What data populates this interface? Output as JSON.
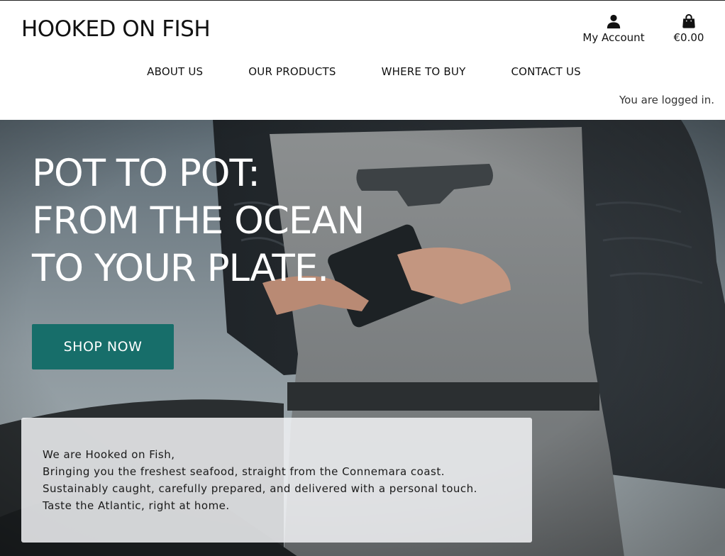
{
  "header": {
    "logo": "HOOKED ON FISH",
    "account_label": "My Account",
    "basket_total": "€0.00",
    "nav": [
      {
        "label": "ABOUT US"
      },
      {
        "label": "OUR PRODUCTS"
      },
      {
        "label": "WHERE TO BUY"
      },
      {
        "label": "CONTACT US"
      }
    ],
    "login_message": "You are logged in."
  },
  "hero": {
    "title_lines": [
      "POT TO POT:",
      "FROM THE OCEAN",
      "TO YOUR PLATE."
    ],
    "cta_label": "SHOP NOW",
    "cta_color": "#176e6a",
    "intro_lines": [
      "We are Hooked on Fish,",
      "Bringing you the freshest seafood, straight from the Connemara coast.",
      "Sustainably caught, carefully prepared, and delivered with a personal touch.",
      "Taste the Atlantic, right at home."
    ]
  },
  "icons": {
    "account": "user-icon",
    "basket": "shopping-bag-icon"
  }
}
